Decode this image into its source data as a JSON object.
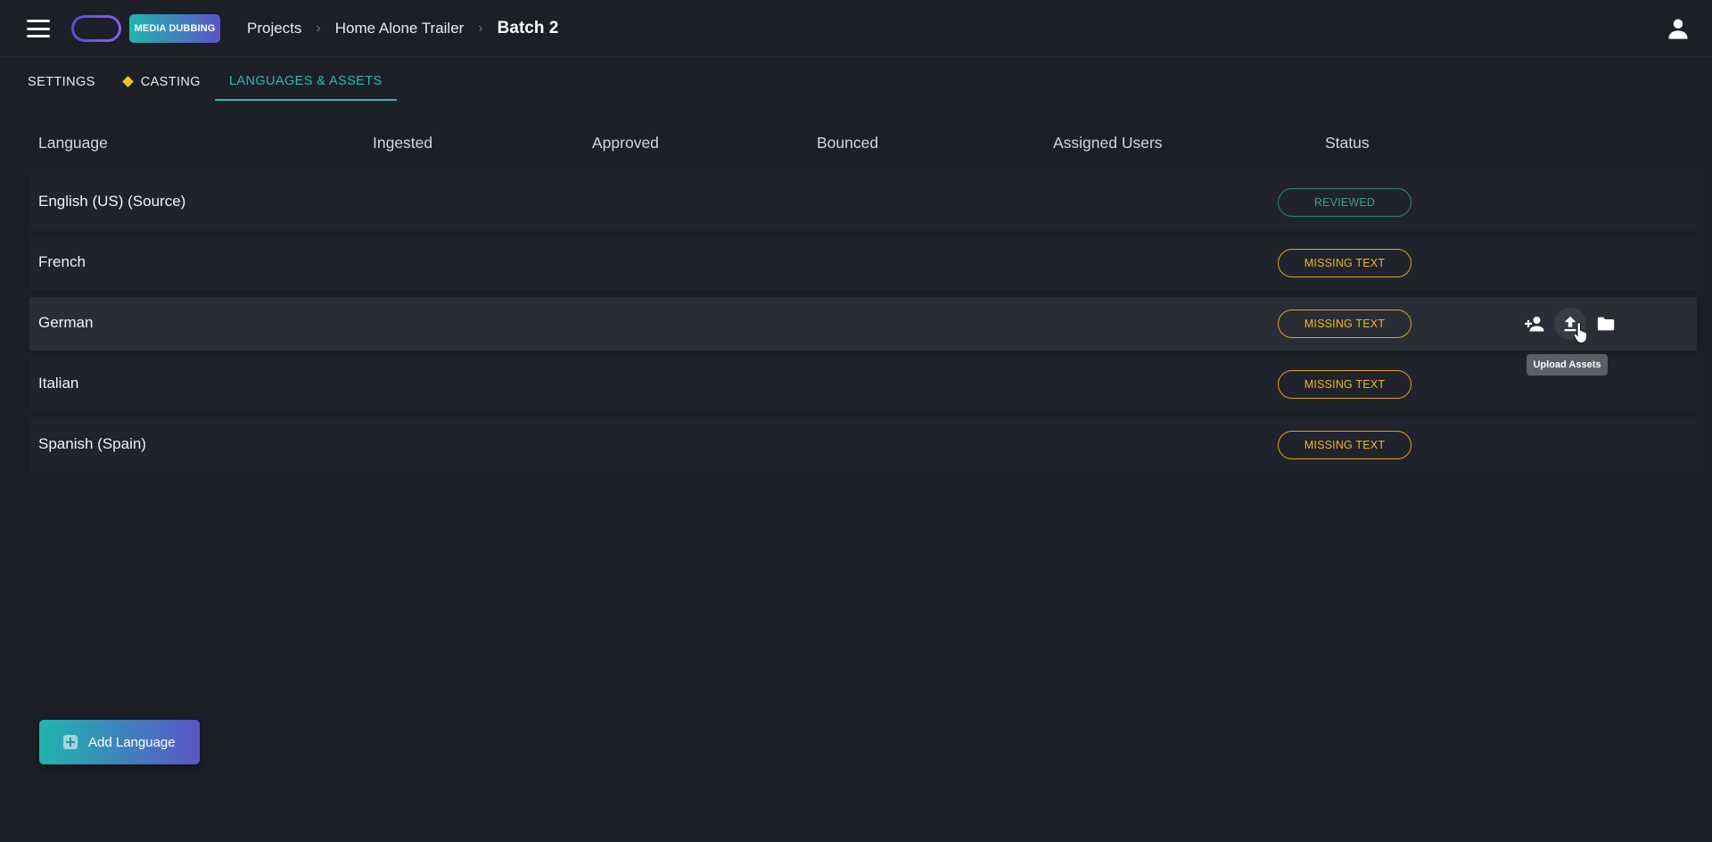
{
  "header": {
    "product_badge": "MEDIA DUBBING",
    "breadcrumb": {
      "projects": "Projects",
      "project": "Home Alone Trailer",
      "current": "Batch 2",
      "separator": "›"
    }
  },
  "tabs": [
    {
      "label": "SETTINGS",
      "active": false
    },
    {
      "label": "CASTING",
      "active": false,
      "warning": true
    },
    {
      "label": "LANGUAGES & ASSETS",
      "active": true
    }
  ],
  "table": {
    "columns": {
      "language": "Language",
      "ingested": "Ingested",
      "approved": "Approved",
      "bounced": "Bounced",
      "assigned_users": "Assigned Users",
      "status": "Status"
    },
    "rows": [
      {
        "language": "English (US) (Source)",
        "status": "REVIEWED"
      },
      {
        "language": "French",
        "status": "MISSING TEXT"
      },
      {
        "language": "German",
        "status": "MISSING TEXT"
      },
      {
        "language": "Italian",
        "status": "MISSING TEXT"
      },
      {
        "language": "Spanish (Spain)",
        "status": "MISSING TEXT"
      }
    ]
  },
  "row_actions": {
    "icons": [
      "add-user-icon",
      "upload-icon",
      "folder-icon"
    ]
  },
  "tooltip": "Upload Assets",
  "add_language_label": "Add Language",
  "colors": {
    "background": "#1c1f26",
    "accent_teal": "#2fb8b8",
    "status_reviewed": "#3fa37a",
    "status_missing": "#f1b71b",
    "warning": "#f3c21c"
  }
}
